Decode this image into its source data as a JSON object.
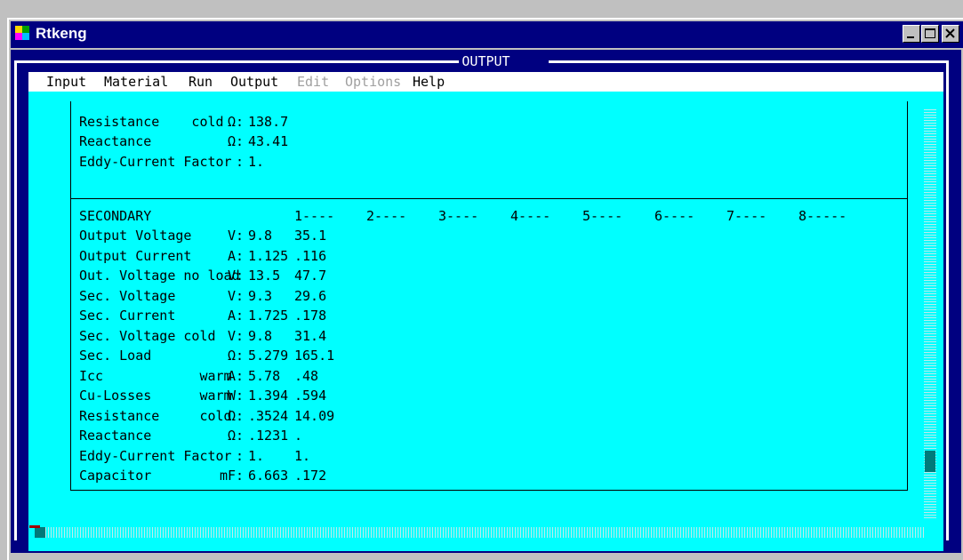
{
  "window": {
    "title": "Rtkeng",
    "buttons": [
      "minimize",
      "maximize",
      "close"
    ]
  },
  "dos_window": {
    "title": "OUTPUT"
  },
  "menu": [
    {
      "label": "Input",
      "enabled": true
    },
    {
      "label": "Material",
      "enabled": true
    },
    {
      "label": "Run",
      "enabled": true
    },
    {
      "label": "Output",
      "enabled": true
    },
    {
      "label": "Edit",
      "enabled": false
    },
    {
      "label": "Options",
      "enabled": false
    },
    {
      "label": "Help",
      "enabled": true
    }
  ],
  "colors": {
    "window_bg": "#c0c0c0",
    "titlebar": "#000080",
    "panel": "#00ffff",
    "menubar": "#ffffff",
    "text": "#000000"
  },
  "primary_rows": [
    {
      "label": "Resistance    cold  ",
      "unit": "Ω:",
      "values": [
        "138.7"
      ]
    },
    {
      "label": "Reactance           ",
      "unit": "Ω:",
      "values": [
        "43.41"
      ]
    },
    {
      "label": "Eddy-Current Factor ",
      "unit": " :",
      "values": [
        "1."
      ]
    }
  ],
  "secondary": {
    "header": {
      "label": "SECONDARY",
      "columns": [
        "1----",
        "2----",
        "3----",
        "4----",
        "5----",
        "6----",
        "7----",
        "8-----"
      ]
    },
    "rows": [
      {
        "label": "Output Voltage      ",
        "unit": "V:",
        "values": [
          "9.8",
          "35.1"
        ]
      },
      {
        "label": "Output Current      ",
        "unit": "A:",
        "values": [
          "1.125",
          ".116"
        ]
      },
      {
        "label": "Out. Voltage no load",
        "unit": "V:",
        "values": [
          "13.5",
          "47.7"
        ]
      },
      {
        "label": "Sec. Voltage        ",
        "unit": "V:",
        "values": [
          "9.3",
          "29.6"
        ]
      },
      {
        "label": "Sec. Current        ",
        "unit": "A:",
        "values": [
          "1.725",
          ".178"
        ]
      },
      {
        "label": "Sec. Voltage cold   ",
        "unit": "V:",
        "values": [
          "9.8",
          "31.4"
        ]
      },
      {
        "label": "Sec. Load           ",
        "unit": "Ω:",
        "values": [
          "5.279",
          "165.1"
        ]
      },
      {
        "label": "Icc            warm ",
        "unit": "A:",
        "values": [
          "5.78",
          ".48"
        ]
      },
      {
        "label": "Cu-Losses      warm ",
        "unit": "W:",
        "values": [
          "1.394",
          ".594"
        ]
      },
      {
        "label": "Resistance     cold ",
        "unit": "Ω:",
        "values": [
          ".3524",
          "14.09"
        ]
      },
      {
        "label": "Reactance           ",
        "unit": "Ω:",
        "values": [
          ".1231",
          "."
        ]
      },
      {
        "label": "Eddy-Current Factor ",
        "unit": " :",
        "values": [
          "1.",
          "1."
        ]
      },
      {
        "label": "Capacitor          ",
        "unit": "mF:",
        "values": [
          "6.663",
          ".172"
        ]
      }
    ]
  },
  "scroll": {
    "vertical_position": 0.88,
    "horizontal_position": 0.0
  }
}
